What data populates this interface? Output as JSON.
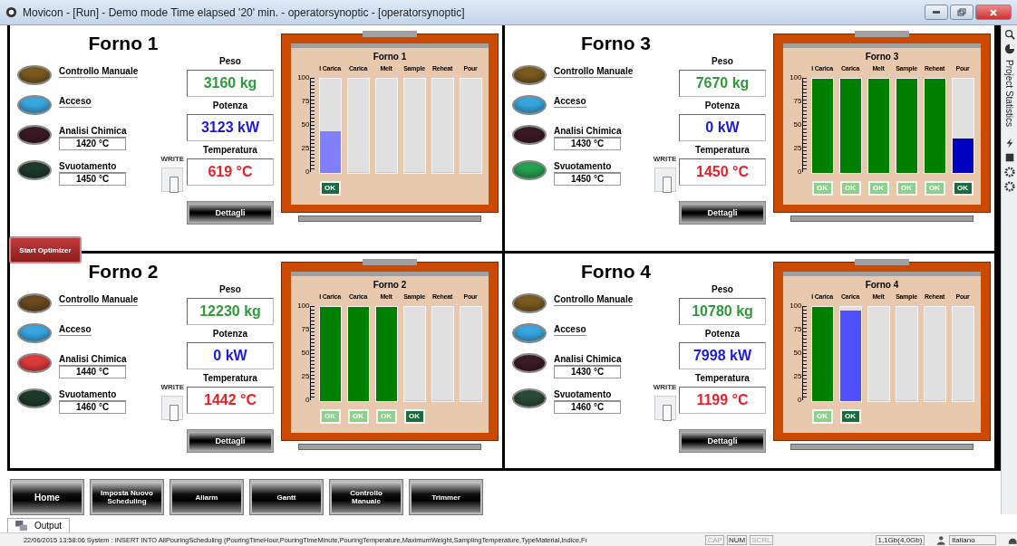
{
  "window": {
    "title": "Movicon - [Run] - Demo mode Time elapsed '20' min. - operatorsynoptic - [operatorsynoptic]"
  },
  "furnaces": [
    {
      "title": "Forno 1",
      "lamps": [
        {
          "label": "Controllo Manuale",
          "color": "#7a5a1e"
        },
        {
          "label": "Acceso",
          "color": "#3aa6e0"
        },
        {
          "label": "Analisi Chimica",
          "value": "1420 °C",
          "color": "#3a1a26"
        },
        {
          "label": "Svuotamento",
          "value": "1450 °C",
          "color": "#1e3a2c"
        }
      ],
      "write_label": "WRITE",
      "switch_on": false,
      "readings": [
        {
          "label": "Peso",
          "value": "3160 kg",
          "kind": "weight"
        },
        {
          "label": "Potenza",
          "value": "3123 kW",
          "kind": "power"
        },
        {
          "label": "Temperatura",
          "value": "619 °C",
          "kind": "temperature"
        }
      ],
      "details_button": "Dettagli",
      "chart_title": "Forno 1",
      "scale": [
        "100",
        "75",
        "50",
        "25",
        "0"
      ],
      "gauges": [
        {
          "label": "I Carica",
          "level": 0.44,
          "color": "#8080ff",
          "ok": {
            "label": "OK",
            "active": true
          }
        },
        {
          "label": "Carica",
          "level": 0
        },
        {
          "label": "Melt",
          "level": 0
        },
        {
          "label": "Sample",
          "level": 0
        },
        {
          "label": "Reheat",
          "level": 0
        },
        {
          "label": "Pour",
          "level": 0
        }
      ]
    },
    {
      "title": "Forno 3",
      "lamps": [
        {
          "label": "Controllo Manuale",
          "color": "#7a5a1e"
        },
        {
          "label": "Acceso",
          "color": "#3aa6e0"
        },
        {
          "label": "Analisi Chimica",
          "value": "1430 °C",
          "color": "#3a1a26"
        },
        {
          "label": "Svuotamento",
          "value": "1450 °C",
          "color": "#27a050"
        }
      ],
      "write_label": "WRITE",
      "switch_on": false,
      "readings": [
        {
          "label": "Peso",
          "value": "7670 kg",
          "kind": "weight"
        },
        {
          "label": "Potenza",
          "value": "0 kW",
          "kind": "power"
        },
        {
          "label": "Temperatura",
          "value": "1450 °C",
          "kind": "temperature"
        }
      ],
      "details_button": "Dettagli",
      "chart_title": "Forno 3",
      "scale": [
        "100",
        "75",
        "50",
        "25",
        "0"
      ],
      "gauges": [
        {
          "label": "I Carica",
          "level": 1,
          "color": "#008000",
          "ok": {
            "label": "OK",
            "active": false
          }
        },
        {
          "label": "Carica",
          "level": 1,
          "color": "#008000",
          "ok": {
            "label": "OK",
            "active": false
          }
        },
        {
          "label": "Melt",
          "level": 1,
          "color": "#008000",
          "ok": {
            "label": "OK",
            "active": false
          }
        },
        {
          "label": "Sample",
          "level": 1,
          "color": "#008000",
          "ok": {
            "label": "OK",
            "active": false
          }
        },
        {
          "label": "Reheat",
          "level": 1,
          "color": "#008000",
          "ok": {
            "label": "OK",
            "active": false
          }
        },
        {
          "label": "Pour",
          "level": 0.37,
          "color": "#0000c0",
          "ok": {
            "label": "OK",
            "active": true
          }
        }
      ]
    },
    {
      "title": "Forno 2",
      "lamps": [
        {
          "label": "Controllo Manuale",
          "color": "#6a4a1e"
        },
        {
          "label": "Acceso",
          "color": "#3aa6e0"
        },
        {
          "label": "Analisi Chimica",
          "value": "1440 °C",
          "color": "#e03a3a"
        },
        {
          "label": "Svuotamento",
          "value": "1460 °C",
          "color": "#1e3a2c"
        }
      ],
      "write_label": "WRITE",
      "switch_on": false,
      "readings": [
        {
          "label": "Peso",
          "value": "12230 kg",
          "kind": "weight"
        },
        {
          "label": "Potenza",
          "value": "0 kW",
          "kind": "power"
        },
        {
          "label": "Temperatura",
          "value": "1442 °C",
          "kind": "temperature"
        }
      ],
      "details_button": "Dettagli",
      "chart_title": "Forno 2",
      "scale": [
        "100",
        "75",
        "50",
        "25",
        "0"
      ],
      "gauges": [
        {
          "label": "I Carica",
          "level": 1,
          "color": "#008000",
          "ok": {
            "label": "OK",
            "active": false
          }
        },
        {
          "label": "Carica",
          "level": 1,
          "color": "#008000",
          "ok": {
            "label": "OK",
            "active": false
          }
        },
        {
          "label": "Melt",
          "level": 1,
          "color": "#008000",
          "ok": {
            "label": "OK",
            "active": false
          }
        },
        {
          "label": "Sample",
          "level": 0,
          "ok": {
            "label": "OK",
            "active": true
          }
        },
        {
          "label": "Reheat",
          "level": 0
        },
        {
          "label": "Pour",
          "level": 0
        }
      ]
    },
    {
      "title": "Forno 4",
      "lamps": [
        {
          "label": "Controllo Manuale",
          "color": "#7a5a1e"
        },
        {
          "label": "Acceso",
          "color": "#3aa6e0"
        },
        {
          "label": "Analisi Chimica",
          "value": "1430 °C",
          "color": "#3a1a26"
        },
        {
          "label": "Svuotamento",
          "value": "1460 °C",
          "color": "#2a4a3a"
        }
      ],
      "write_label": "WRITE",
      "switch_on": false,
      "readings": [
        {
          "label": "Peso",
          "value": "10780 kg",
          "kind": "weight"
        },
        {
          "label": "Potenza",
          "value": "7998 kW",
          "kind": "power"
        },
        {
          "label": "Temperatura",
          "value": "1199 °C",
          "kind": "temperature"
        }
      ],
      "details_button": "Dettagli",
      "chart_title": "Forno 4",
      "scale": [
        "100",
        "75",
        "50",
        "25",
        "0"
      ],
      "gauges": [
        {
          "label": "I Carica",
          "level": 1,
          "color": "#008000",
          "ok": {
            "label": "OK",
            "active": false
          }
        },
        {
          "label": "Carica",
          "level": 0.96,
          "color": "#5050ff",
          "ok": {
            "label": "OK",
            "active": true
          }
        },
        {
          "label": "Melt",
          "level": 0
        },
        {
          "label": "Sample",
          "level": 0
        },
        {
          "label": "Reheat",
          "level": 0
        },
        {
          "label": "Pour",
          "level": 0
        }
      ]
    }
  ],
  "start_optimizer": "Start Optimizer",
  "sidebar": {
    "label": "Project Statistics"
  },
  "nav_buttons": [
    "Home",
    "Imposta Nuovo Scheduling",
    "Allarm",
    "Gantt",
    "Controllo Manuale",
    "Trimmer"
  ],
  "output_tab": "Output",
  "status_bar": {
    "message": "22/06/2015 13:58:06 System : INSERT INTO AllPouringScheduling (PouringTimeHour,PouringTimeMinute,PouringTemperature,MaximumWeight,SamplingTemperature,TypeMaterial,Indice,Fı",
    "indicators": [
      {
        "label": "CAP",
        "on": false
      },
      {
        "label": "NUM",
        "on": true
      },
      {
        "label": "SCRL",
        "on": false
      }
    ],
    "memory": "1,1Gb(4,0Gb)",
    "language": "Italiano"
  }
}
